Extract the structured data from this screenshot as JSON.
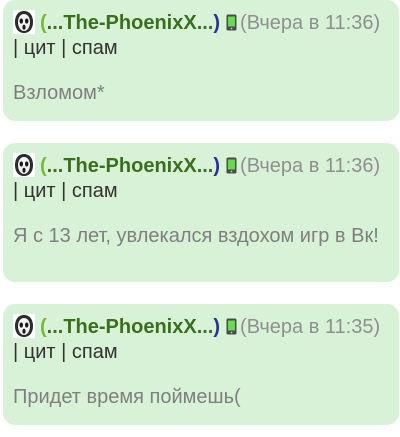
{
  "posts": [
    {
      "nick_open": "(",
      "nick_name": "...The-PhoenixX...",
      "nick_close": ")",
      "time": "(Вчера в 11:36)",
      "cit_label": "цит",
      "spam_label": "спам",
      "separator": "|",
      "message": "Взломом*"
    },
    {
      "nick_open": "(",
      "nick_name": "...The-PhoenixX...",
      "nick_close": ")",
      "time": "(Вчера в 11:36)",
      "cit_label": "цит",
      "spam_label": "спам",
      "separator": "|",
      "message": "Я с 13 лет, увлекался вздохом игр в Вк!"
    },
    {
      "nick_open": "(",
      "nick_name": "...The-PhoenixX...",
      "nick_close": ")",
      "time": "(Вчера в 11:35)",
      "cit_label": "цит",
      "spam_label": "спам",
      "separator": "|",
      "message": "Придет время поймешь("
    }
  ],
  "icons": {
    "avatar": "ghostface-mask-avatar",
    "device": "mobile-phone-icon"
  },
  "colors": {
    "post_background": "#d8f2d7",
    "nick_green": "#7bb83a",
    "nick_dark": "#3a6f1f",
    "muted_text": "#7f7f7f"
  }
}
